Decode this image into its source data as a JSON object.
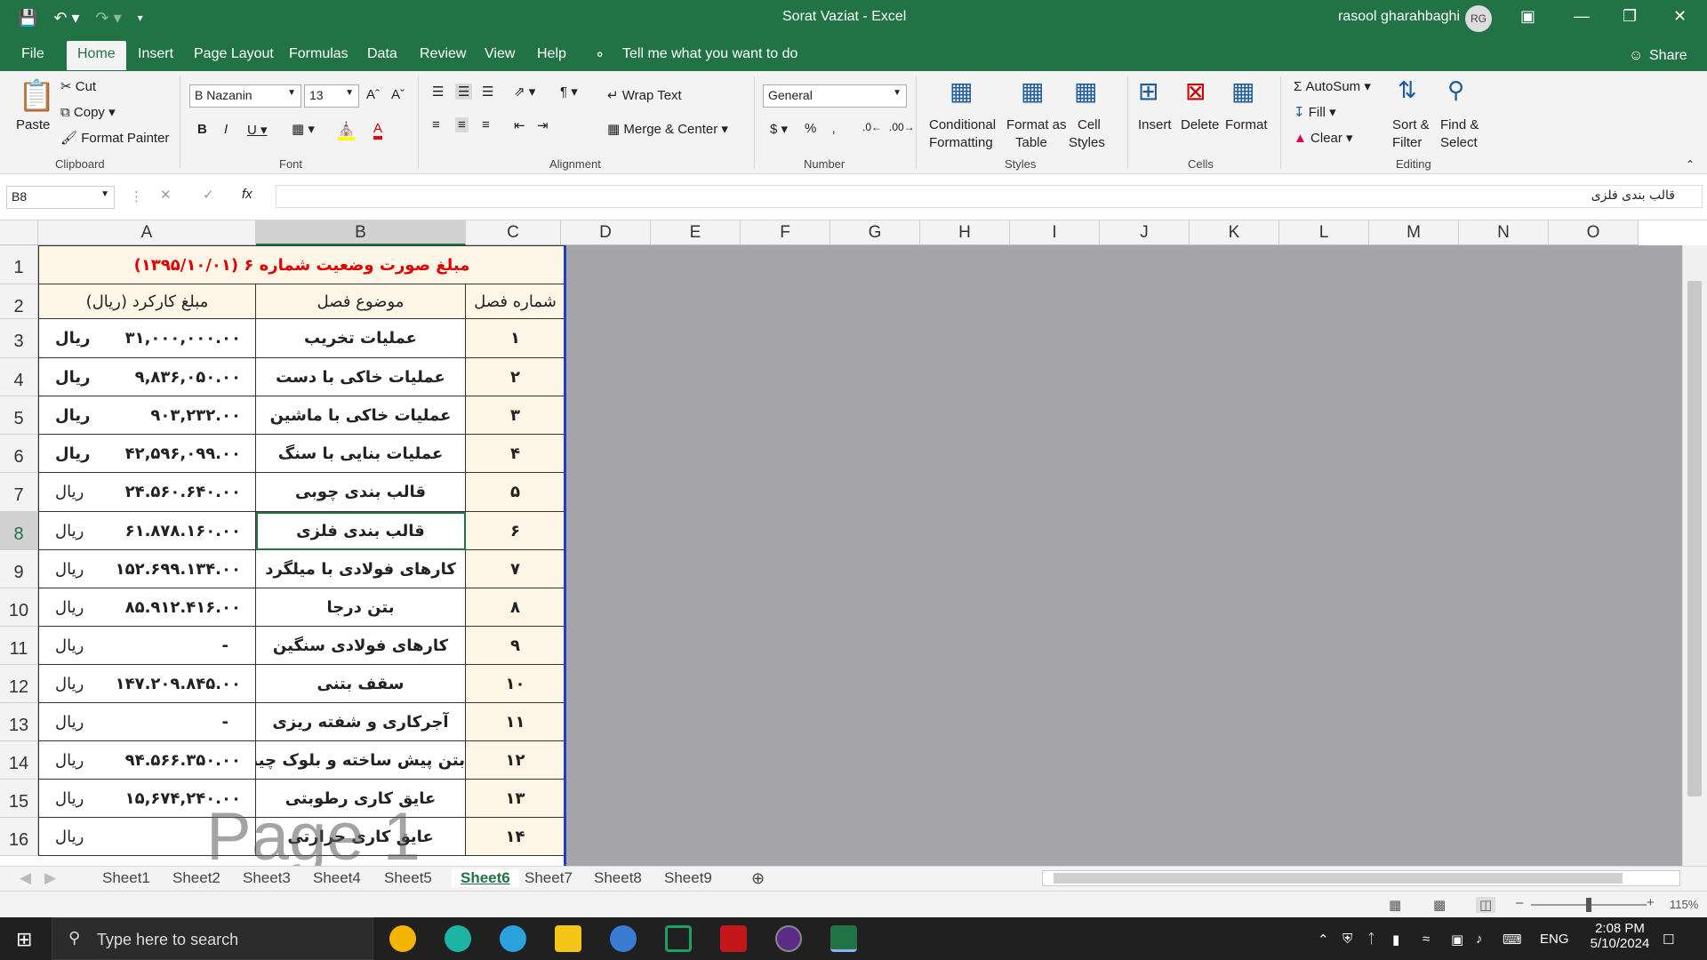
{
  "window": {
    "title": "Sorat Vaziat  -  Excel",
    "user": "rasool gharahbaghi",
    "avatar": "RG"
  },
  "ribbon_tabs": [
    "File",
    "Home",
    "Insert",
    "Page Layout",
    "Formulas",
    "Data",
    "Review",
    "View",
    "Help"
  ],
  "tell_me": "Tell me what you want to do",
  "share": "Share",
  "clipboard": {
    "paste": "Paste",
    "cut": "Cut",
    "copy": "Copy",
    "format_painter": "Format Painter",
    "label": "Clipboard"
  },
  "font": {
    "name": "B Nazanin",
    "size": "13",
    "label": "Font"
  },
  "alignment": {
    "wrap": "Wrap Text",
    "merge": "Merge & Center",
    "label": "Alignment"
  },
  "number": {
    "format": "General",
    "label": "Number"
  },
  "styles": {
    "conditional": "Conditional",
    "conditional2": "Formatting",
    "format_as": "Format as",
    "table": "Table",
    "cell": "Cell",
    "cell_styles": "Styles",
    "label": "Styles"
  },
  "cells": {
    "insert": "Insert",
    "delete": "Delete",
    "format": "Format",
    "label": "Cells"
  },
  "editing": {
    "autosum": "AutoSum",
    "fill": "Fill",
    "clear": "Clear",
    "sort": "Sort &",
    "filter": "Filter",
    "find": "Find &",
    "select": "Select",
    "label": "Editing"
  },
  "formula_bar": {
    "name_box": "B8",
    "content": "قالب بندی فلزی"
  },
  "columns": [
    "A",
    "B",
    "C",
    "D",
    "E",
    "F",
    "G",
    "H",
    "I",
    "J",
    "K",
    "L",
    "M",
    "N",
    "O"
  ],
  "rows": [
    "1",
    "2",
    "3",
    "4",
    "5",
    "6",
    "7",
    "8",
    "9",
    "10",
    "11",
    "12",
    "13",
    "14",
    "15",
    "16"
  ],
  "sheet": {
    "title": "مبلغ صورت وضعیت شماره ۶  (۱۳۹۵/۱۰/۰۱)",
    "headers": {
      "a": "مبلغ کارکرد (ریال)",
      "b": "موضوع فصل",
      "c": "شماره فصل"
    },
    "data": [
      {
        "c": "۱",
        "b": "عملیات تخریب",
        "amt": "۳۱,۰۰۰,۰۰۰.۰۰",
        "cur": "ریال"
      },
      {
        "c": "۲",
        "b": "عملیات خاکی با دست",
        "amt": "۹,۸۳۶,۰۵۰.۰۰",
        "cur": "ریال"
      },
      {
        "c": "۳",
        "b": "عملیات خاکی با ماشین",
        "amt": "۹۰۳,۲۳۲.۰۰",
        "cur": "ریال"
      },
      {
        "c": "۴",
        "b": "عملیات بنایی با سنگ",
        "amt": "۴۲,۵۹۶,۰۹۹.۰۰",
        "cur": "ریال"
      },
      {
        "c": "۵",
        "b": "قالب بندی چوبی",
        "amt": "۲۴.۵۶۰.۶۴۰.۰۰",
        "cur": "ریال"
      },
      {
        "c": "۶",
        "b": "قالب بندی فلزی",
        "amt": "۶۱.۸۷۸.۱۶۰.۰۰",
        "cur": "ریال"
      },
      {
        "c": "۷",
        "b": "کارهای فولادی با میلگرد",
        "amt": "۱۵۲.۶۹۹.۱۳۴.۰۰",
        "cur": "ریال"
      },
      {
        "c": "۸",
        "b": "بتن درجا",
        "amt": "۸۵.۹۱۲.۴۱۶.۰۰",
        "cur": "ریال"
      },
      {
        "c": "۹",
        "b": "کارهای فولادی سنگین",
        "amt": "-",
        "cur": "ریال"
      },
      {
        "c": "۱۰",
        "b": "سقف بتنی",
        "amt": "۱۴۷.۲۰۹.۸۴۵.۰۰",
        "cur": "ریال"
      },
      {
        "c": "۱۱",
        "b": "آجرکاری و شفته ریزی",
        "amt": "-",
        "cur": "ریال"
      },
      {
        "c": "۱۲",
        "b": "بتن پیش ساخته و بلوک چینی",
        "amt": "۹۴.۵۶۶.۳۵۰.۰۰",
        "cur": "ریال"
      },
      {
        "c": "۱۳",
        "b": "عایق کاری رطوبتی",
        "amt": "۱۵,۶۷۴,۲۴۰.۰۰",
        "cur": "ریال"
      },
      {
        "c": "۱۴",
        "b": "عایق کاری حرارتی",
        "amt": "",
        "cur": "ریال"
      }
    ]
  },
  "watermark": "Page 1",
  "sheet_tabs": [
    "Sheet1",
    "Sheet2",
    "Sheet3",
    "Sheet4",
    "Sheet5",
    "Sheet6",
    "Sheet7",
    "Sheet8",
    "Sheet9"
  ],
  "active_sheet": "Sheet6",
  "status": {
    "zoom": "115%"
  },
  "taskbar": {
    "search": "Type here to search",
    "lang": "ENG",
    "time": "2:08 PM",
    "date": "5/10/2024"
  }
}
